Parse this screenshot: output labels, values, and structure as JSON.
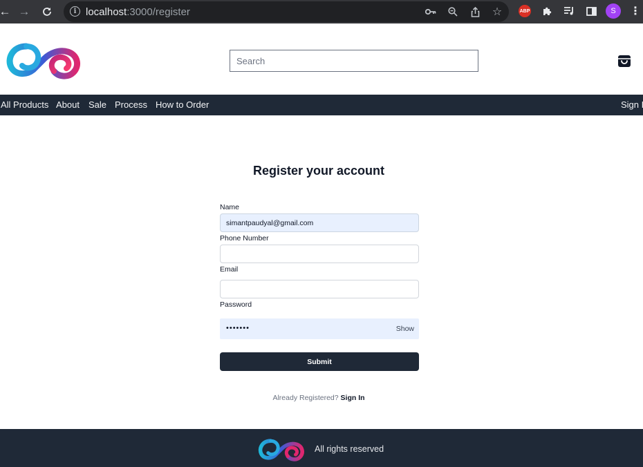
{
  "browser": {
    "url_host": "localhost",
    "url_path": ":3000/register",
    "profile_initial": "S",
    "abp_label": "ABP",
    "icons": [
      "back-icon",
      "forward-icon",
      "reload-icon",
      "info-icon",
      "key-icon",
      "zoom-icon",
      "share-icon",
      "star-icon",
      "puzzle-icon",
      "playlist-icon",
      "sidepanel-icon",
      "menu-icon"
    ]
  },
  "header": {
    "search_placeholder": "Search"
  },
  "nav": {
    "items": [
      "All Products",
      "About",
      "Sale",
      "Process",
      "How to Order"
    ],
    "sign_in": "Sign In"
  },
  "form": {
    "title": "Register your account",
    "name_label": "Name",
    "name_value": "simantpaudyal@gmail.com",
    "phone_label": "Phone Number",
    "phone_value": "",
    "email_label": "Email",
    "email_value": "",
    "password_label": "Password",
    "password_dots": "•••••••",
    "show_label": "Show",
    "submit_label": "Submit",
    "already_text": "Already Registered?",
    "signin_link": "Sign In"
  },
  "footer": {
    "text": "All rights reserved"
  },
  "colors": {
    "dark": "#1f2937",
    "chrome": "#35363a",
    "autofill": "#e8f0fe"
  }
}
